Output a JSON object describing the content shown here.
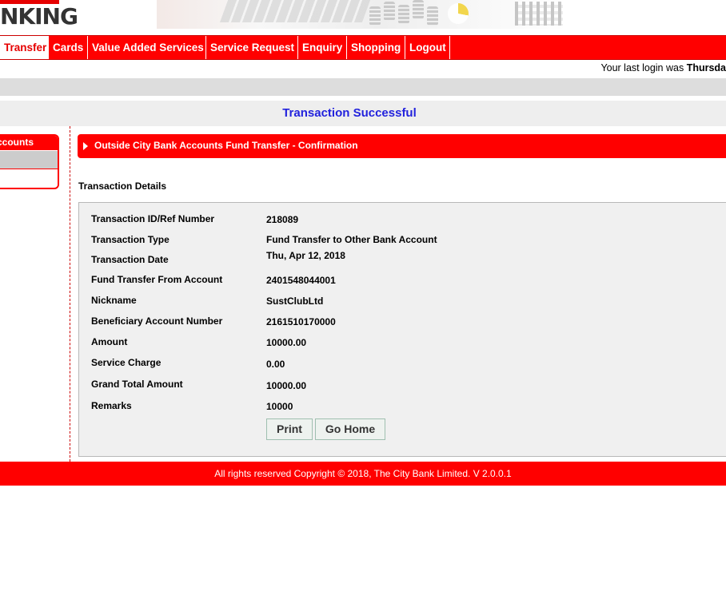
{
  "header": {
    "logo_text": "NKING"
  },
  "nav": {
    "items": [
      {
        "label": "Transfer"
      },
      {
        "label": "Cards"
      },
      {
        "label": "Value Added Services"
      },
      {
        "label": "Service Request"
      },
      {
        "label": "Enquiry"
      },
      {
        "label": "Shopping"
      },
      {
        "label": "Logout"
      }
    ]
  },
  "login": {
    "prefix": "Your last login was ",
    "day": "Thursda"
  },
  "page_title": "Transaction Successful",
  "sidebar": {
    "heading": "ccounts"
  },
  "section": {
    "title": "Outside City Bank Accounts Fund Transfer - Confirmation"
  },
  "details": {
    "heading": "Transaction Details",
    "rows": [
      {
        "label": "Transaction ID/Ref Number",
        "value": "218089"
      },
      {
        "label": "Transaction Type",
        "value": "Fund Transfer to Other Bank Account"
      },
      {
        "label": "Transaction Date",
        "value": "Thu, Apr 12, 2018"
      },
      {
        "label": "Fund Transfer From Account",
        "value": "2401548044001"
      },
      {
        "label": "Nickname",
        "value": "SustClubLtd"
      },
      {
        "label": "Beneficiary Account Number",
        "value": "2161510170000"
      },
      {
        "label": "Amount",
        "value": "10000.00"
      },
      {
        "label": "Service Charge",
        "value": "0.00"
      },
      {
        "label": "Grand Total Amount",
        "value": "10000.00"
      },
      {
        "label": "Remarks",
        "value": "10000"
      }
    ]
  },
  "buttons": {
    "print": "Print",
    "home": "Go Home"
  },
  "footer": {
    "text": "All rights reserved Copyright © 2018, The City Bank Limited. V 2.0.0.1"
  },
  "colors": {
    "brand_red": "#ff0000",
    "title_blue": "#2222dd",
    "panel_grey": "#f0f0f0"
  }
}
